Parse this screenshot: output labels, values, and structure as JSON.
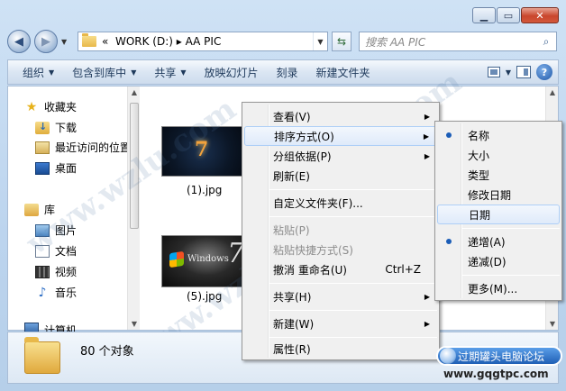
{
  "address": {
    "breadcrumb": "«  WORK (D:) ▸ AA PIC"
  },
  "search": {
    "placeholder": "搜索 AA PIC"
  },
  "toolbar": {
    "organize": "组织",
    "include_library": "包含到库中",
    "share": "共享",
    "slideshow": "放映幻灯片",
    "burn": "刻录",
    "new_folder": "新建文件夹"
  },
  "sidebar": {
    "favorites": "收藏夹",
    "items": [
      "下载",
      "最近访问的位置",
      "桌面"
    ],
    "library": "库",
    "library_items": [
      "图片",
      "文档",
      "视频",
      "音乐"
    ],
    "computer": "计算机"
  },
  "files": [
    {
      "name": "(1).jpg"
    },
    {
      "name": "(5).jpg"
    }
  ],
  "status": {
    "count": "80 个对象"
  },
  "context_menu": {
    "view": "查看(V)",
    "sort_by": "排序方式(O)",
    "group_by": "分组依据(P)",
    "refresh": "刷新(E)",
    "customize": "自定义文件夹(F)...",
    "paste": "粘贴(P)",
    "paste_shortcut": "粘贴快捷方式(S)",
    "undo": "撤消 重命名(U)",
    "undo_shortcut": "Ctrl+Z",
    "share": "共享(H)",
    "new": "新建(W)",
    "properties": "属性(R)"
  },
  "sort_menu": {
    "name": "名称",
    "size": "大小",
    "type": "类型",
    "date_modified": "修改日期",
    "date": "日期",
    "ascending": "递增(A)",
    "descending": "递减(D)",
    "more": "更多(M)..."
  },
  "badge": {
    "title": "过期罐头电脑论坛",
    "url": "www.gqgtpc.com"
  },
  "watermark": {
    "text": "www.wzlu.com"
  }
}
